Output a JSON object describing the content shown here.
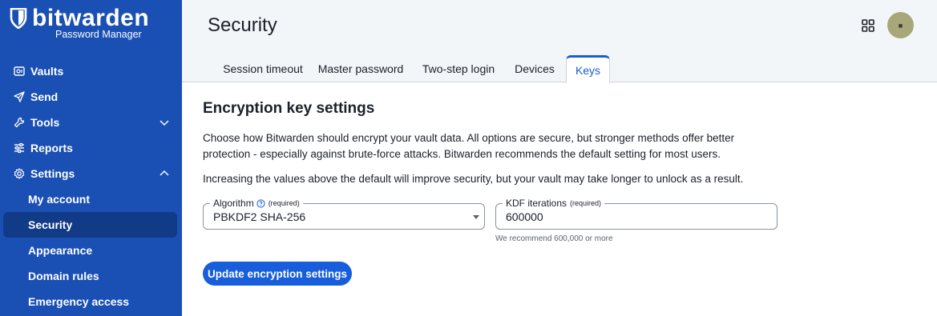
{
  "brand": {
    "name": "bitwarden",
    "subtitle": "Password Manager"
  },
  "sidebar": {
    "items": [
      {
        "label": "Vaults",
        "icon": "vault-icon"
      },
      {
        "label": "Send",
        "icon": "send-icon"
      },
      {
        "label": "Tools",
        "icon": "wrench-icon",
        "expandable": true,
        "expanded": false
      },
      {
        "label": "Reports",
        "icon": "sliders-icon"
      },
      {
        "label": "Settings",
        "icon": "gear-icon",
        "expandable": true,
        "expanded": true
      }
    ],
    "settings_subitems": [
      {
        "label": "My account",
        "active": false
      },
      {
        "label": "Security",
        "active": true
      },
      {
        "label": "Appearance",
        "active": false
      },
      {
        "label": "Domain rules",
        "active": false
      },
      {
        "label": "Emergency access",
        "active": false
      }
    ]
  },
  "header": {
    "title": "Security",
    "avatar_initials": "■"
  },
  "tabs": [
    {
      "label": "Session timeout",
      "active": false
    },
    {
      "label": "Master password",
      "active": false
    },
    {
      "label": "Two-step login",
      "active": false
    },
    {
      "label": "Devices",
      "active": false
    },
    {
      "label": "Keys",
      "active": true
    }
  ],
  "main": {
    "section_title": "Encryption key settings",
    "description_line1": "Choose how Bitwarden should encrypt your vault data. All options are secure, but stronger methods offer better",
    "description_line2": "protection - especially against brute-force attacks. Bitwarden recommends the default setting for most users.",
    "note": "Increasing the values above the default will improve security, but your vault may take longer to unlock as a result.",
    "algorithm": {
      "label": "Algorithm",
      "required": "(required)",
      "value": "PBKDF2 SHA-256"
    },
    "kdf_iterations": {
      "label": "KDF iterations",
      "required": "(required)",
      "value": "600000",
      "hint": "We recommend 600,000 or more"
    },
    "submit_label": "Update encryption settings"
  },
  "colors": {
    "sidebar_bg": "#1a4fb4",
    "sidebar_active": "#113b86",
    "accent": "#175ddc",
    "header_bg": "#f3f6f9"
  }
}
